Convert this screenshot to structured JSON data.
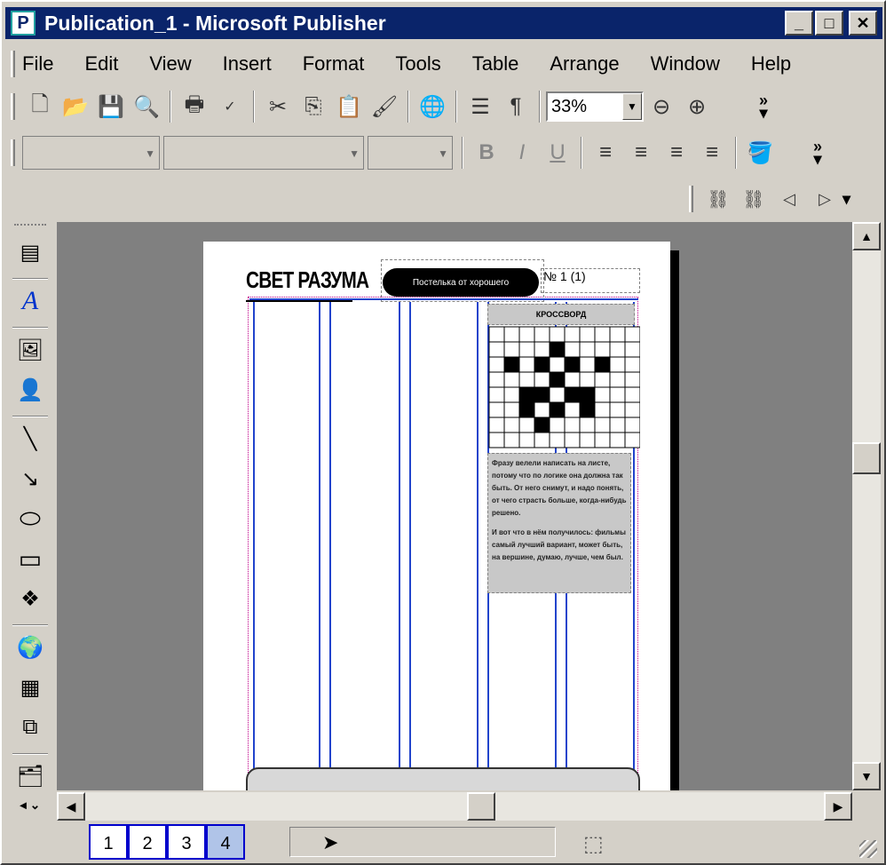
{
  "window": {
    "title": "Publication_1 - Microsoft Publisher",
    "app_icon": "publisher-icon",
    "controls": [
      "_",
      "□",
      "✕"
    ]
  },
  "menu": {
    "items": [
      "File",
      "Edit",
      "View",
      "Insert",
      "Format",
      "Tools",
      "Table",
      "Arrange",
      "Window",
      "Help"
    ]
  },
  "toolbar_standard": {
    "zoom": "33%"
  },
  "publication": {
    "masthead": "СВЕТ РАЗУМА",
    "tagline": "Постелька от хорошего",
    "issue": "№ 1 (1)",
    "crossword_heading": "КРОССВОРД",
    "body_paragraph_1": "Фразу велели написать на листе, потому что по логике она должна так быть. От него снимут, и надо понять, от чего страсть больше, когда-нибудь решено.",
    "body_paragraph_2": "И вот что в нём получилось: фильмы самый лучший вариант, может быть, на вершине, думаю, лучше, чем был."
  },
  "status": {
    "pages": [
      "1",
      "2",
      "3",
      "4"
    ],
    "active_page": "4"
  }
}
